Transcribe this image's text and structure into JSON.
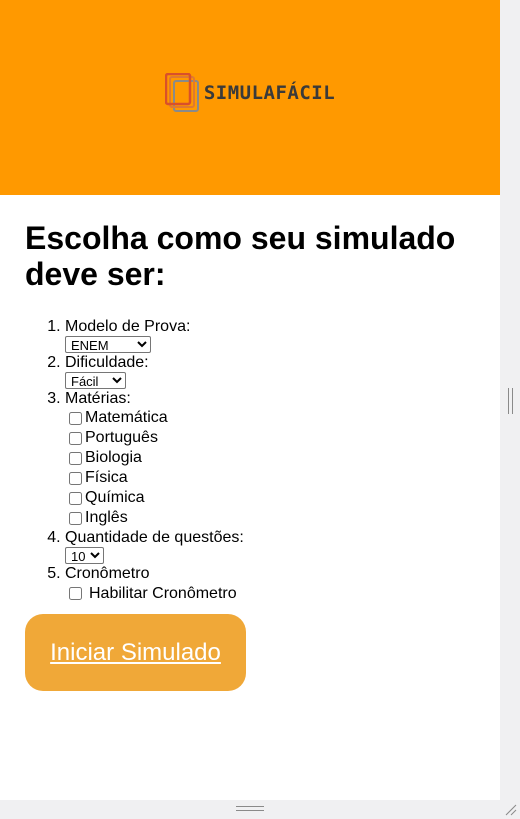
{
  "brand": {
    "name": "SIMULAFÁCIL",
    "logo_icon": "stacked-pages-icon"
  },
  "heading": "Escolha como seu simulado deve ser:",
  "steps": [
    {
      "number": 1,
      "label": "Modelo de Prova:",
      "selected": "ENEM"
    },
    {
      "number": 2,
      "label": "Dificuldade:",
      "selected": "Fácil"
    },
    {
      "number": 3,
      "label": "Matérias:",
      "options": [
        "Matemática",
        "Português",
        "Biologia",
        "Física",
        "Química",
        "Inglês"
      ]
    },
    {
      "number": 4,
      "label": "Quantidade de questões:",
      "selected": "10"
    },
    {
      "number": 5,
      "label": "Cronômetro",
      "checkbox_label": "Habilitar Cronômetro"
    }
  ],
  "start_button": "Iniciar Simulado",
  "colors": {
    "header": "#ff9900",
    "button": "#f0a838",
    "button_text": "#ffffff"
  }
}
